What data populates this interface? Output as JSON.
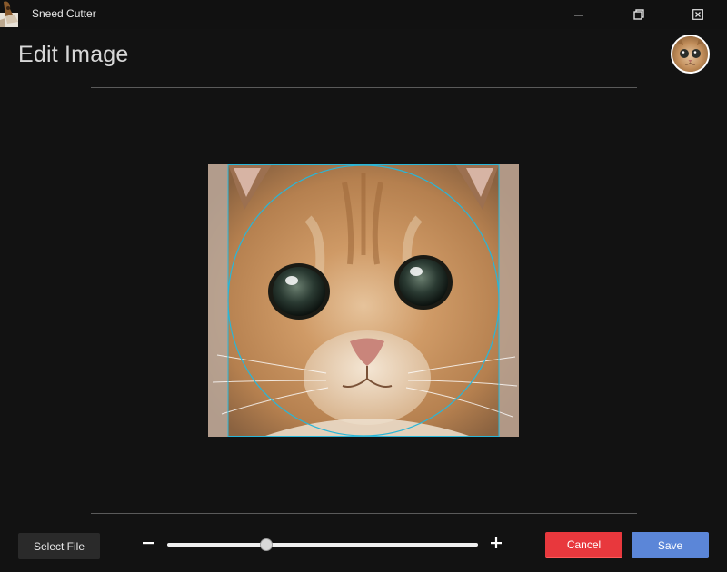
{
  "window": {
    "title": "Sneed Cutter",
    "icons": {
      "app": "tabby-cat-icon",
      "minimize": "minimize-icon",
      "restore": "restore-icon",
      "close": "close-icon"
    }
  },
  "header": {
    "title": "Edit Image",
    "avatar_icon": "cat-avatar-icon"
  },
  "editor": {
    "image": "cat-face-photo",
    "crop_shape": "circle",
    "crop_color": "#29b6d8"
  },
  "toolbar": {
    "select_file_label": "Select File",
    "zoom_out_icon": "minus-icon",
    "zoom_in_icon": "plus-icon",
    "zoom_value": 0.32,
    "cancel_label": "Cancel",
    "save_label": "Save"
  },
  "colors": {
    "background": "#121212",
    "cancel": "#e8383d",
    "save": "#5b86d8",
    "select_file": "#2a2a2a"
  }
}
